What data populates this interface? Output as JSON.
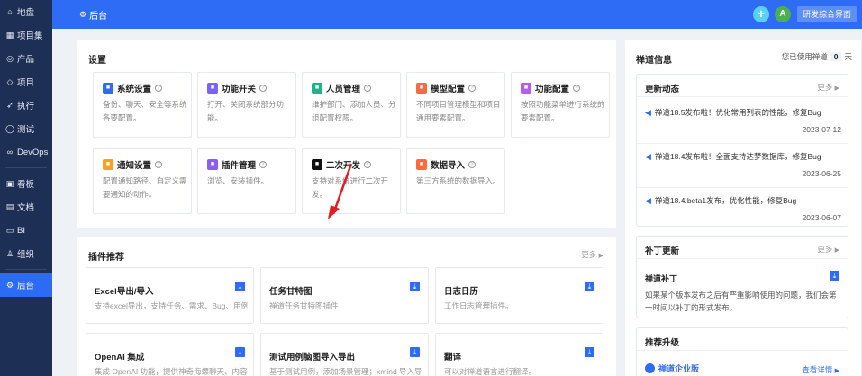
{
  "sidebar": {
    "items": [
      {
        "icon": "home-icon",
        "glyph": "⌂",
        "label": "地盘"
      },
      {
        "icon": "grid-icon",
        "glyph": "▦",
        "label": "项目集"
      },
      {
        "icon": "product-icon",
        "glyph": "◎",
        "label": "产品"
      },
      {
        "icon": "project-icon",
        "glyph": "◇",
        "label": "项目"
      },
      {
        "icon": "execute-icon",
        "glyph": "➶",
        "label": "执行"
      },
      {
        "icon": "test-icon",
        "glyph": "◯",
        "label": "测试"
      },
      {
        "icon": "devops-icon",
        "glyph": "∞",
        "label": "DevOps"
      },
      {
        "icon": "kanban-icon",
        "glyph": "▣",
        "label": "看板"
      },
      {
        "icon": "doc-icon",
        "glyph": "▤",
        "label": "文档"
      },
      {
        "icon": "bi-icon",
        "glyph": "▭",
        "label": "BI"
      },
      {
        "icon": "org-icon",
        "glyph": "♙",
        "label": "组织"
      },
      {
        "icon": "admin-icon",
        "glyph": "⚙",
        "label": "后台"
      }
    ]
  },
  "topbar": {
    "title": "后台",
    "avatar_letter": "A",
    "switch_button": "研发综合界面"
  },
  "settings": {
    "title": "设置",
    "cards": [
      {
        "name": "系统设置",
        "color": "#2f6cf5",
        "icon": "system-settings-icon",
        "desc": "备份、聊天、安全等系统各要配置。"
      },
      {
        "name": "功能开关",
        "color": "#7b61ff",
        "icon": "toggle-icon",
        "desc": "打开、关闭系统部分功能。"
      },
      {
        "name": "人员管理",
        "color": "#1fb387",
        "icon": "people-icon",
        "desc": "维护部门、添加人员、分组配置权限。"
      },
      {
        "name": "模型配置",
        "color": "#f56b4a",
        "icon": "model-icon",
        "desc": "不同项目管理模型和项目通用要素配置。"
      },
      {
        "name": "功能配置",
        "color": "#b45ee8",
        "icon": "feature-config-icon",
        "desc": "按照功能菜单进行系统的要素配置。"
      },
      {
        "name": "通知设置",
        "color": "#ff9f1c",
        "icon": "notify-icon",
        "desc": "配置通知路径、自定义需要通知的动作。"
      },
      {
        "name": "插件管理",
        "color": "#8b5cf6",
        "icon": "plugin-icon",
        "desc": "浏览、安装插件。"
      },
      {
        "name": "二次开发",
        "color": "#111111",
        "icon": "code-icon",
        "desc": "支持对系统进行二次开发。"
      },
      {
        "name": "数据导入",
        "color": "#ff6a3d",
        "icon": "import-icon",
        "desc": "第三方系统的数据导入。"
      }
    ]
  },
  "plugins": {
    "title": "插件推荐",
    "more": "更多",
    "cards": [
      {
        "name": "Excel导出/导入",
        "desc": "支持excel导出，支持任务、需求、Bug、用例"
      },
      {
        "name": "任务甘特图",
        "desc": "禅道任务甘特图插件"
      },
      {
        "name": "日志日历",
        "desc": "工作日志管理插件。"
      },
      {
        "name": "OpenAI 集成",
        "desc": "集成 OpenAI 功能，提供神奇海螺聊天、内容"
      },
      {
        "name": "测试用例脑图导入导出",
        "desc": "基于测试用例，添加场景管理；xmind 导入导"
      },
      {
        "name": "翻译",
        "desc": "可以对禅道语言进行翻译。"
      }
    ]
  },
  "zentao_info": {
    "title": "禅道信息",
    "used_prefix": "您已使用禅道",
    "used_days": "0",
    "used_suffix": "天"
  },
  "updates": {
    "title": "更新动态",
    "more": "更多",
    "items": [
      {
        "text": "禅道18.5发布啦！优化常用列表的性能，修复Bug",
        "date": "2023-07-12"
      },
      {
        "text": "禅道18.4发布啦！全面支持达梦数据库，修复Bug",
        "date": "2023-06-25"
      },
      {
        "text": "禅道18.4.beta1发布，优化性能，修复Bug",
        "date": "2023-06-07"
      }
    ]
  },
  "patches": {
    "title": "补丁更新",
    "more": "更多",
    "item_title": "禅道补丁",
    "item_desc": "如果某个版本发布之后有严重影响使用的问题，我们会第一时间以补丁的形式发布。"
  },
  "upgrade": {
    "title": "推荐升级",
    "item_name": "禅道企业版",
    "details": "查看详情"
  }
}
